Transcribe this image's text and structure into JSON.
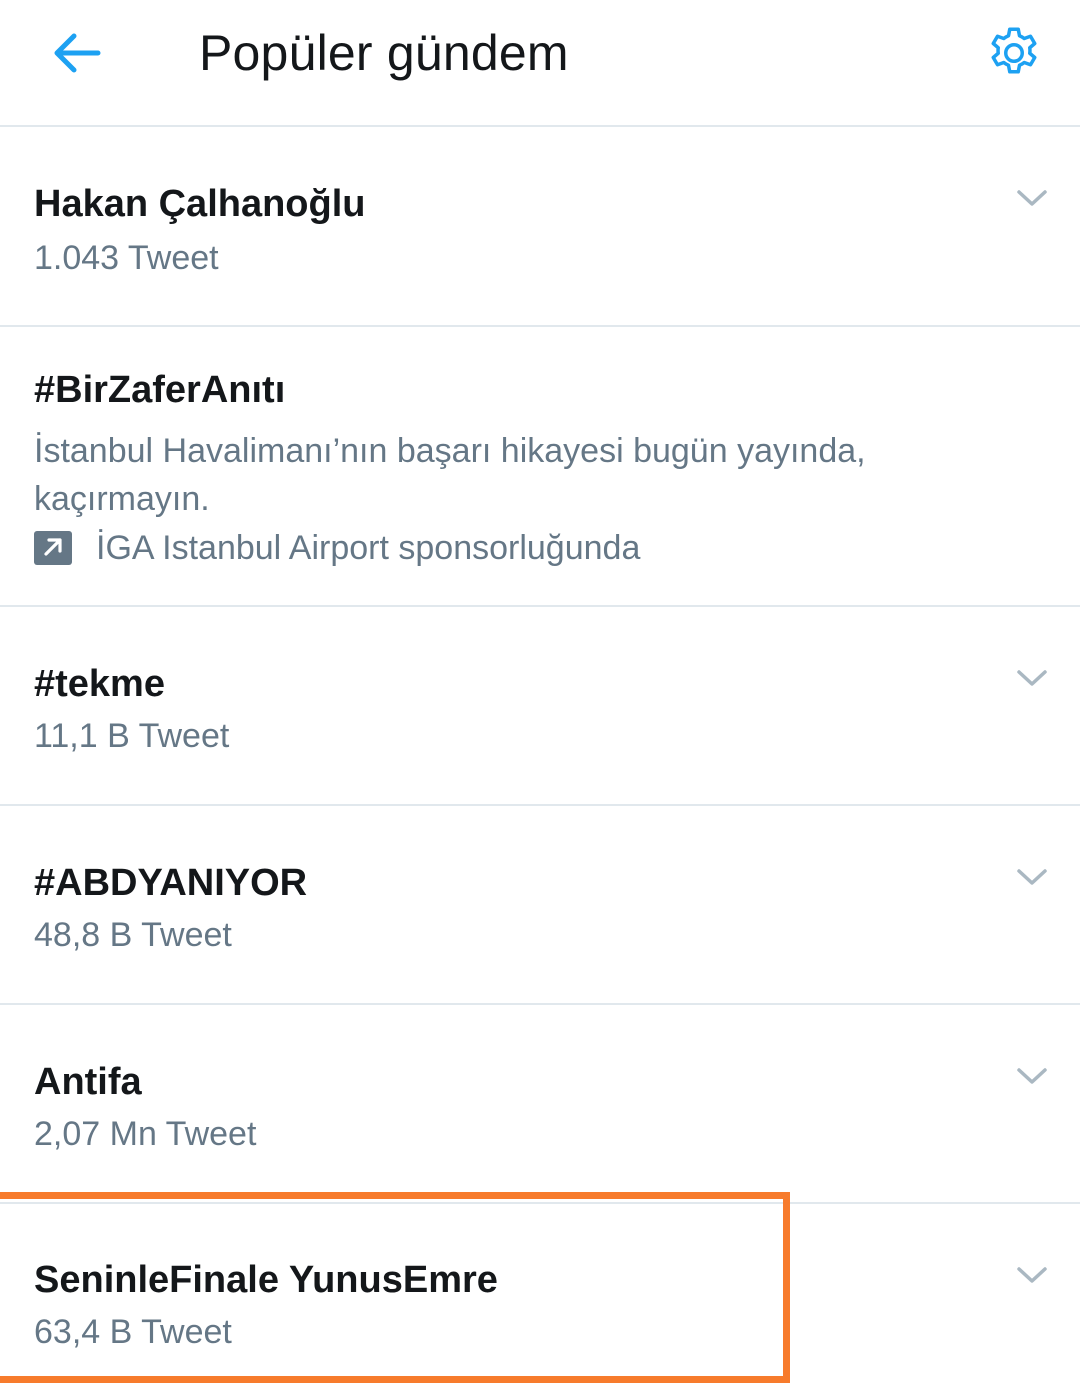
{
  "header": {
    "title": "Popüler gündem",
    "back_icon": "arrow-left-icon",
    "settings_icon": "gear-icon"
  },
  "colors": {
    "accent": "#1da1f2",
    "text_primary": "#14171a",
    "text_secondary": "#657786",
    "divider": "#e1e8ed",
    "highlight": "#f77b2c"
  },
  "trends": [
    {
      "name": "Hakan Çalhanoğlu",
      "count": "1.043 Tweet"
    },
    {
      "name": "#BirZaferAnıtı",
      "description": "İstanbul Havalimanı’nın başarı hikayesi bugün yayında, kaçırmayın.",
      "promoted_by": "İGA Istanbul Airport sponsorluğunda",
      "promoted_icon": "promoted-arrow-icon"
    },
    {
      "name": "#tekme",
      "count": "11,1 B Tweet"
    },
    {
      "name": "#ABDYANIYOR",
      "count": "48,8 B Tweet"
    },
    {
      "name": "Antifa",
      "count": "2,07 Mn Tweet"
    },
    {
      "name": "SeninleFinale YunusEmre",
      "count": "63,4 B Tweet",
      "highlighted": true
    }
  ]
}
